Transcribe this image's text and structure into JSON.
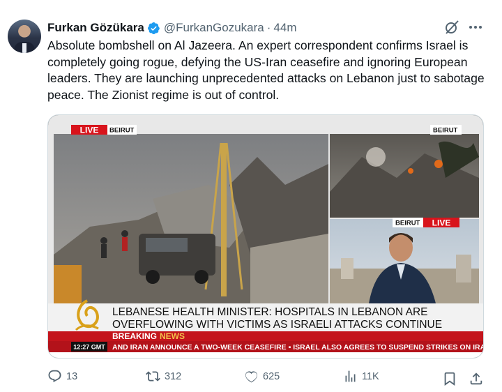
{
  "tweet": {
    "author_name": "Furkan Gözükara",
    "handle": "@FurkanGozukara",
    "separator": "·",
    "time": "44m",
    "text": "Absolute bombshell on Al Jazeera. An expert correspondent confirms Israel is completely going rogue, defying the US-Iran ceasefire and ignoring European leaders. They are launching unprecedented attacks on Lebanon just to sabotage peace. The Zionist regime is out of control."
  },
  "broadcast": {
    "live_label": "LIVE",
    "location_main": "BEIRUT",
    "location_top_right": "BEIRUT",
    "location_bottom_right": "BEIRUT",
    "live_label_2": "LIVE",
    "headline_line1": "LEBANESE HEALTH MINISTER: HOSPITALS IN LEBANON ARE",
    "headline_line2": "OVERFLOWING WITH VICTIMS AS ISRAELI ATTACKS CONTINUE",
    "breaking_word1": "BREAKING",
    "breaking_word2": "NEWS",
    "clock": "12:27 GMT",
    "ticker": "AND IRAN ANNOUNCE A TWO-WEEK CEASEFIRE  ▪  ISRAEL ALSO AGREES TO SUSPEND STRIKES ON IRAN"
  },
  "metrics": {
    "replies": "13",
    "retweets": "312",
    "likes": "625",
    "views": "11K"
  },
  "icons": [
    "verified-badge-icon",
    "grok-icon",
    "more-icon",
    "reply-icon",
    "retweet-icon",
    "like-icon",
    "views-icon",
    "bookmark-icon",
    "share-icon"
  ],
  "colors": {
    "verified": "#1d9bf0",
    "live_red": "#d8141c",
    "breaking_red": "#c4151c",
    "secondary_text": "#536471"
  }
}
